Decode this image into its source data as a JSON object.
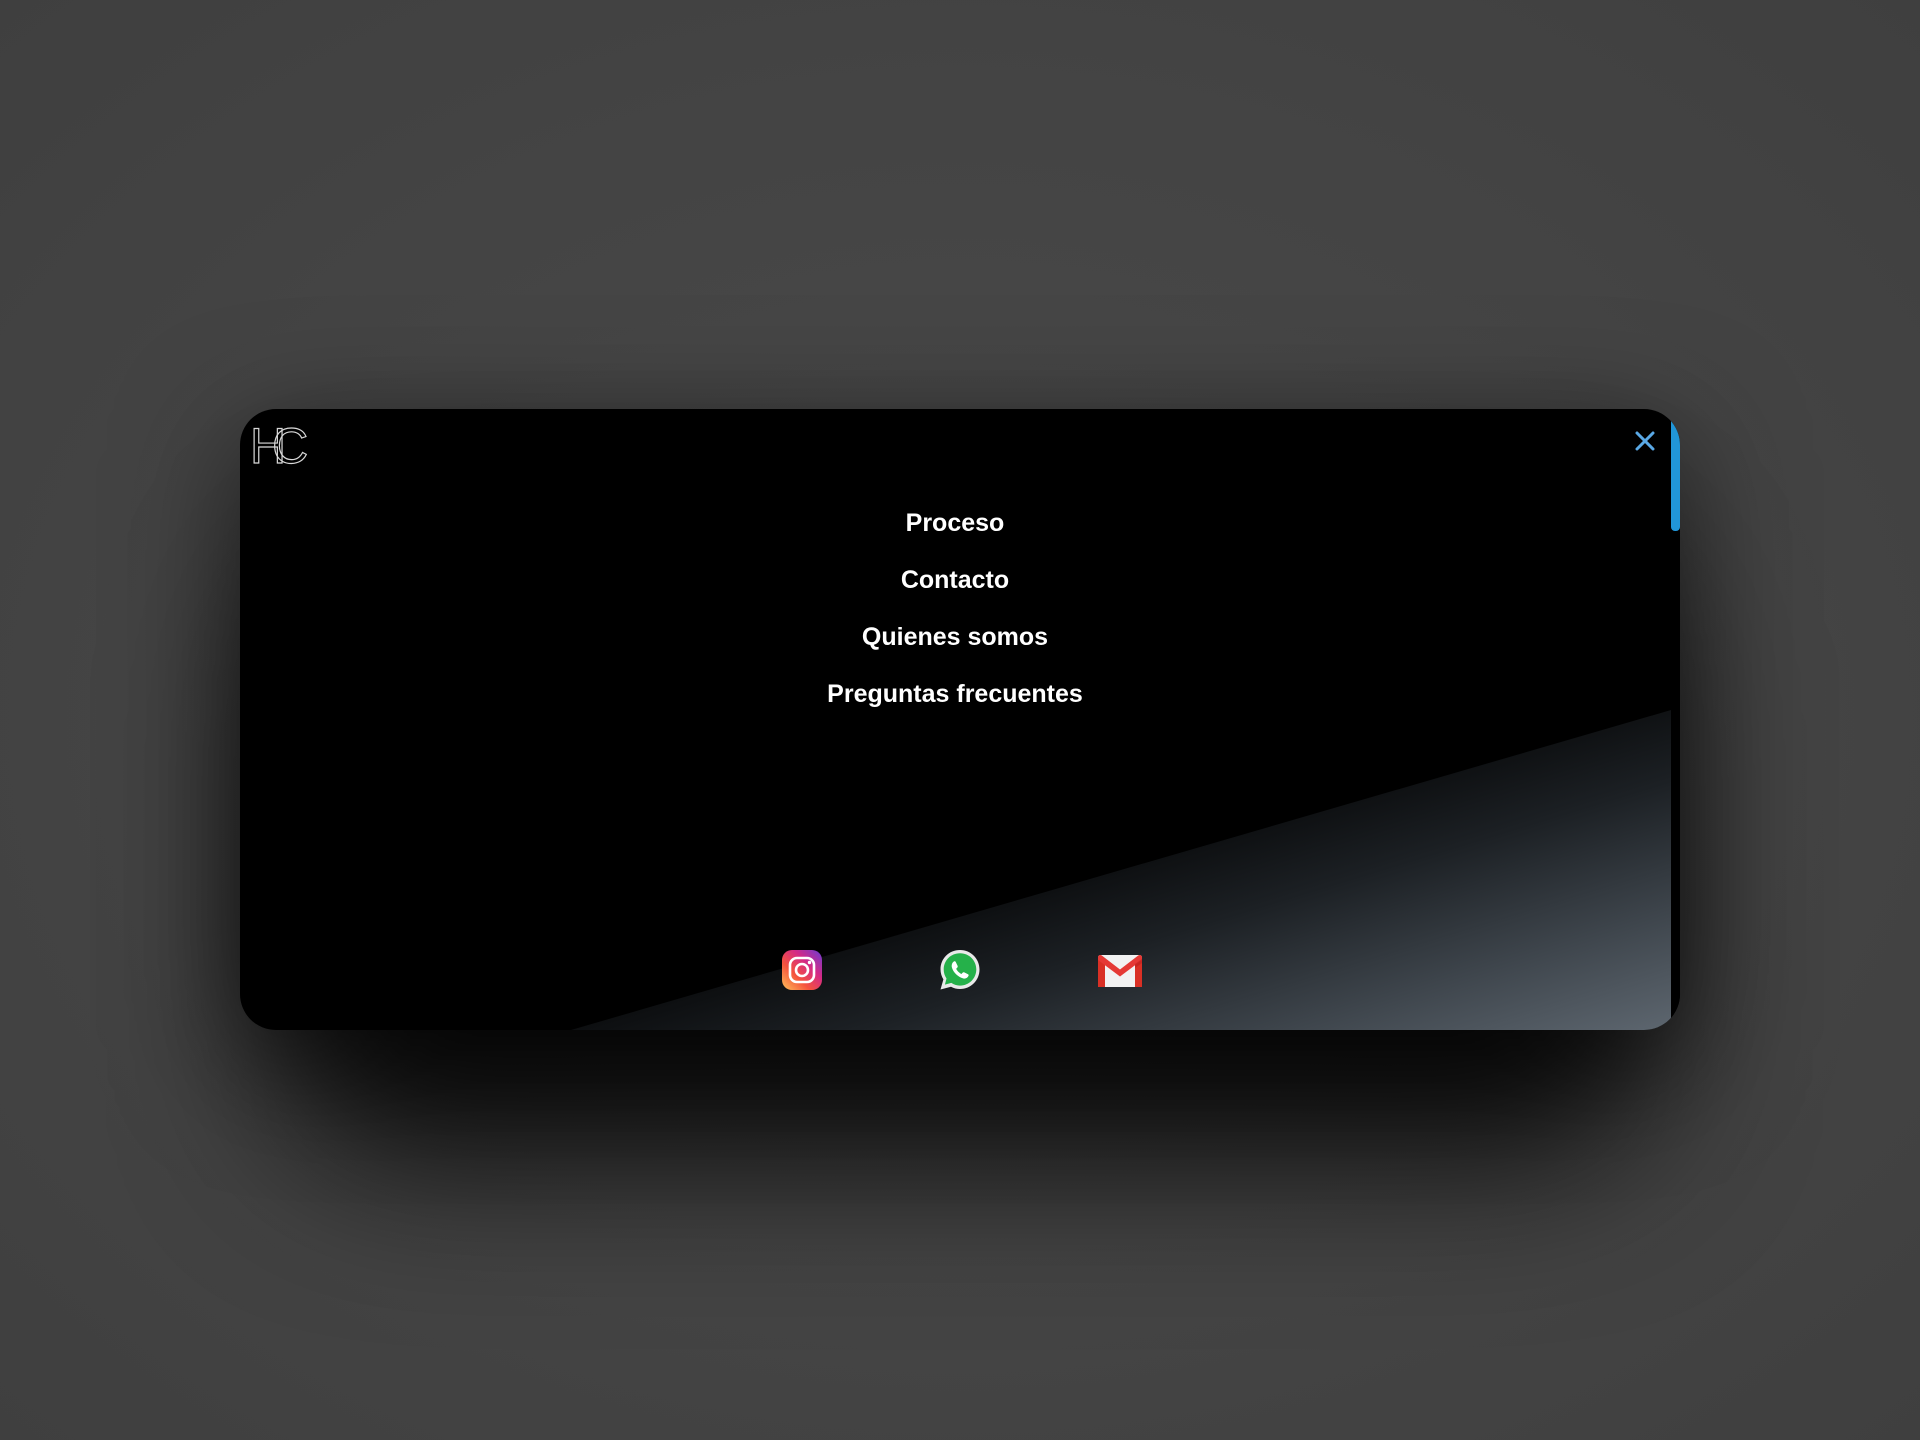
{
  "brand": {
    "logo_text": "HC",
    "logo_icon": "hc-monogram-logo"
  },
  "close_icon": "close-icon",
  "accent_color": "#2196d8",
  "nav": {
    "items": [
      {
        "label": "Proceso"
      },
      {
        "label": "Contacto"
      },
      {
        "label": "Quienes somos"
      },
      {
        "label": "Preguntas frecuentes"
      }
    ]
  },
  "socials": {
    "items": [
      {
        "icon": "instagram-icon"
      },
      {
        "icon": "whatsapp-icon"
      },
      {
        "icon": "gmail-icon"
      }
    ]
  }
}
